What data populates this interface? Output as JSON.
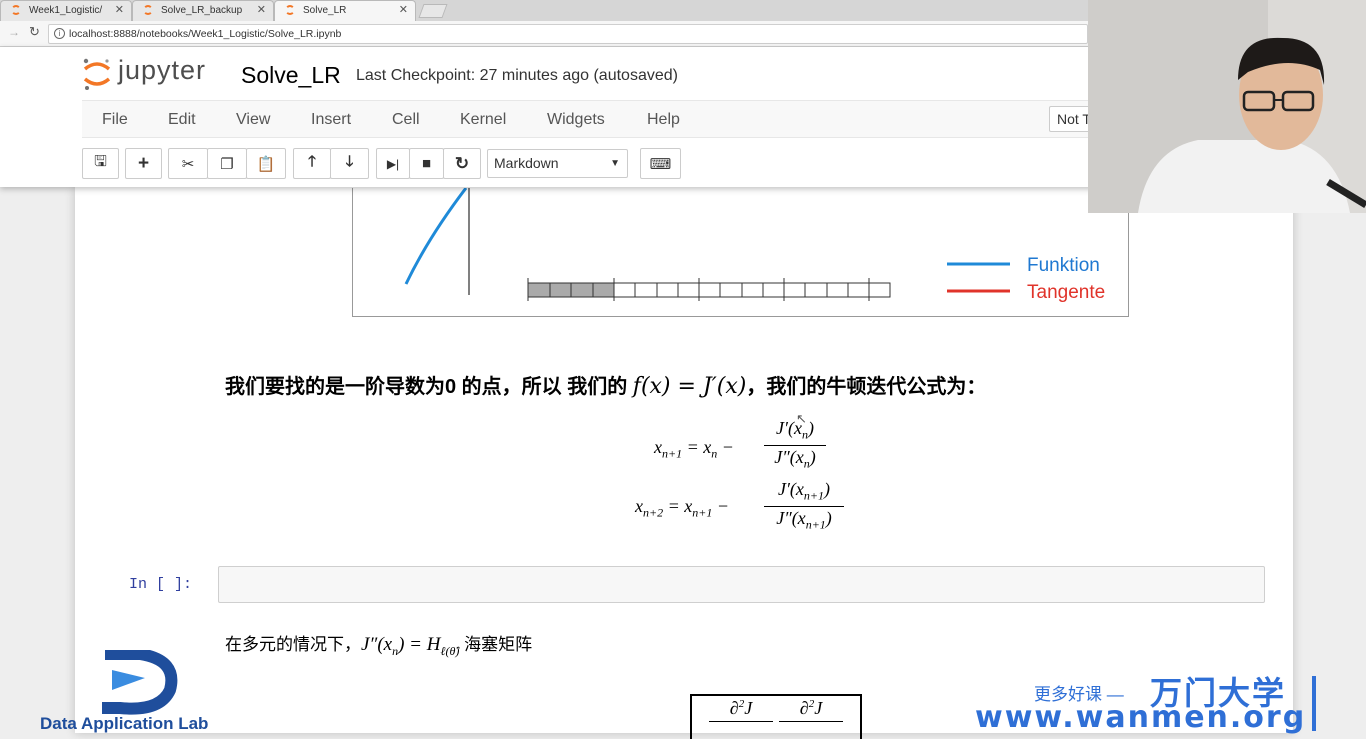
{
  "browser": {
    "tabs": [
      {
        "label": "Week1_Logistic/"
      },
      {
        "label": "Solve_LR_backup"
      },
      {
        "label": "Solve_LR"
      }
    ],
    "url": "localhost:8888/notebooks/Week1_Logistic/Solve_LR.ipynb"
  },
  "jupyter": {
    "logo_text": "jupyter",
    "notebook_title": "Solve_LR",
    "checkpoint": "Last Checkpoint: 27 minutes ago (autosaved)",
    "menu": [
      "File",
      "Edit",
      "View",
      "Insert",
      "Cell",
      "Kernel",
      "Widgets",
      "Help"
    ],
    "trusted_label": "Not T",
    "cell_type": "Markdown",
    "toolbar_icons": [
      "save-icon",
      "plus-icon",
      "cut-icon",
      "copy-icon",
      "paste-icon",
      "arrow-up-icon",
      "arrow-down-icon",
      "step-forward-icon",
      "stop-icon",
      "restart-icon",
      "keyboard-icon"
    ]
  },
  "plot": {
    "legend": [
      {
        "label": "Funktion",
        "color": "#1f78d1"
      },
      {
        "label": "Tangente",
        "color": "#e0332a"
      }
    ]
  },
  "markdown": {
    "heading_prefix": "我们要找的是一阶导数为0 的点，所以 我们的 ",
    "heading_suffix": "，我们的牛顿迭代公式为：",
    "hessian_prefix": "在多元的情况下，",
    "hessian_suffix": " 海塞矩阵"
  },
  "code_cell": {
    "prompt": "In  [  ]:"
  },
  "overlays": {
    "dal_text": "Data Application Lab",
    "slogan": "更多好课 —",
    "brand": "万门大学",
    "url": "www.wanmen.org"
  }
}
